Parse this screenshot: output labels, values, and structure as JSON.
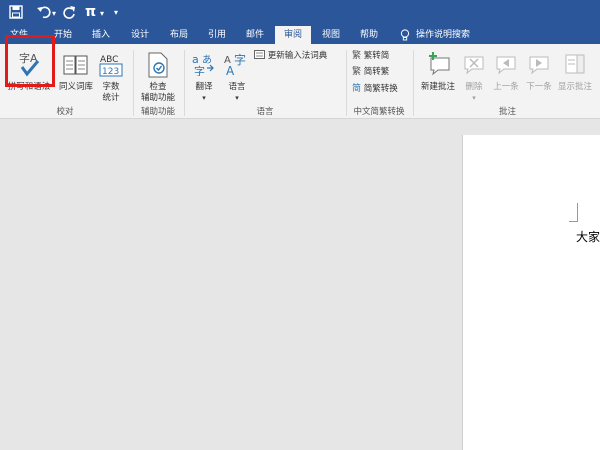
{
  "quick_access": {
    "save_icon": "save-icon",
    "undo_icon": "undo-icon",
    "redo_icon": "redo-icon",
    "equation_label": "π",
    "dropdown_glyph": "▾",
    "customize_glyph": "▾"
  },
  "tabs": [
    "文件",
    "开始",
    "插入",
    "设计",
    "布局",
    "引用",
    "邮件",
    "审阅",
    "视图",
    "帮助"
  ],
  "active_tab": "审阅",
  "tell_me": "操作说明搜索",
  "ribbon": {
    "proofing": {
      "spelling": "拼写和语法",
      "thesaurus": "同义词库",
      "word_count_1": "字数",
      "word_count_2": "统计",
      "label": "校对"
    },
    "accessibility": {
      "check_1": "检查",
      "check_2": "辅助功能",
      "label": "辅助功能"
    },
    "language": {
      "translate": "翻译",
      "language": "语言",
      "update_ime": "更新输入法词典",
      "label": "语言"
    },
    "chinese_conversion": {
      "to_simplified": "繁转简",
      "to_traditional": "简转繁",
      "convert": "简繁转换",
      "label": "中文简繁转换"
    },
    "comments": {
      "new_comment": "新建批注",
      "delete": "删除",
      "previous": "上一条",
      "next": "下一条",
      "show_comments": "显示批注",
      "label": "批注"
    }
  },
  "document": {
    "text": "大家"
  },
  "colors": {
    "titlebar": "#2b579a",
    "ribbon": "#f3f3f3",
    "highlight": "#e21a1a",
    "workspace": "#e6e6e6"
  }
}
